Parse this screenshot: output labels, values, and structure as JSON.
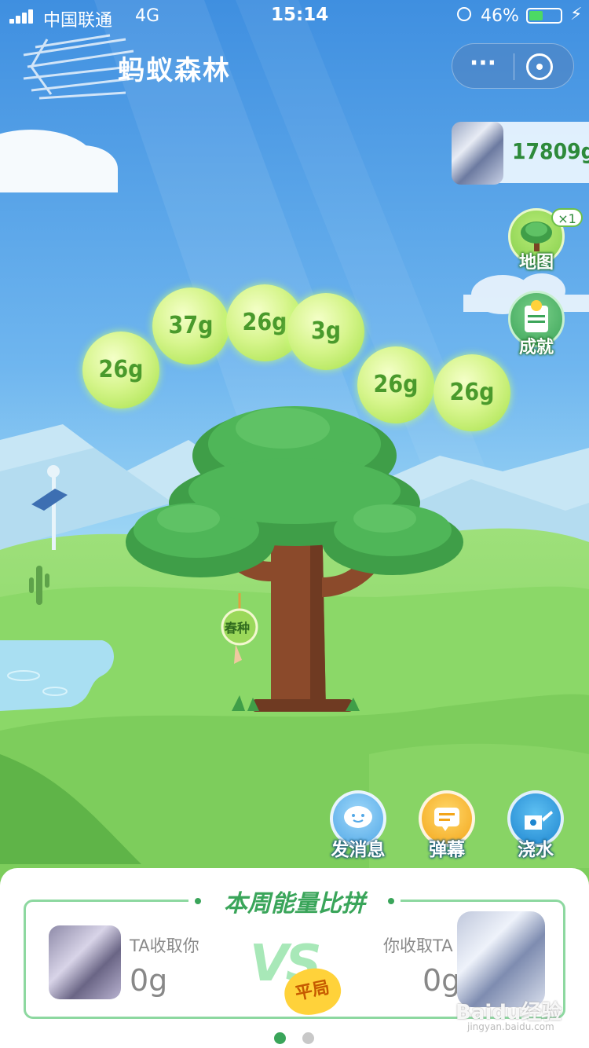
{
  "status_bar": {
    "carrier": "中国联通",
    "network": "4G",
    "time": "15:14",
    "battery_pct": "46%",
    "battery_level": 0.46
  },
  "header": {
    "title": "蚂蚁森林",
    "more_label": "···"
  },
  "energy": {
    "total": "17809g"
  },
  "side_menu": {
    "map_label": "地图",
    "map_badge": "×1",
    "achievement_label": "成就"
  },
  "energy_balls": [
    "26g",
    "37g",
    "26g",
    "3g",
    "26g",
    "26g"
  ],
  "tree": {
    "tag_label": "春种"
  },
  "actions": {
    "message_label": "发消息",
    "barrage_label": "弹幕",
    "water_label": "浇水"
  },
  "weekly_pk": {
    "title": "本周能量比拼",
    "left_label": "TA收取你",
    "left_value": "0g",
    "vs_label": "VS",
    "result_label": "平局",
    "right_label": "你收取TA",
    "right_value": "0g"
  },
  "pager": {
    "active_index": 0,
    "count": 2
  },
  "watermark": {
    "text": "Baidu经验",
    "sub": "jingyan.baidu.com"
  },
  "colors": {
    "accent_green": "#3aa55a",
    "energy_green": "#2d8a3a",
    "sky_top": "#3f8fe0",
    "grass": "#7fd15a"
  }
}
